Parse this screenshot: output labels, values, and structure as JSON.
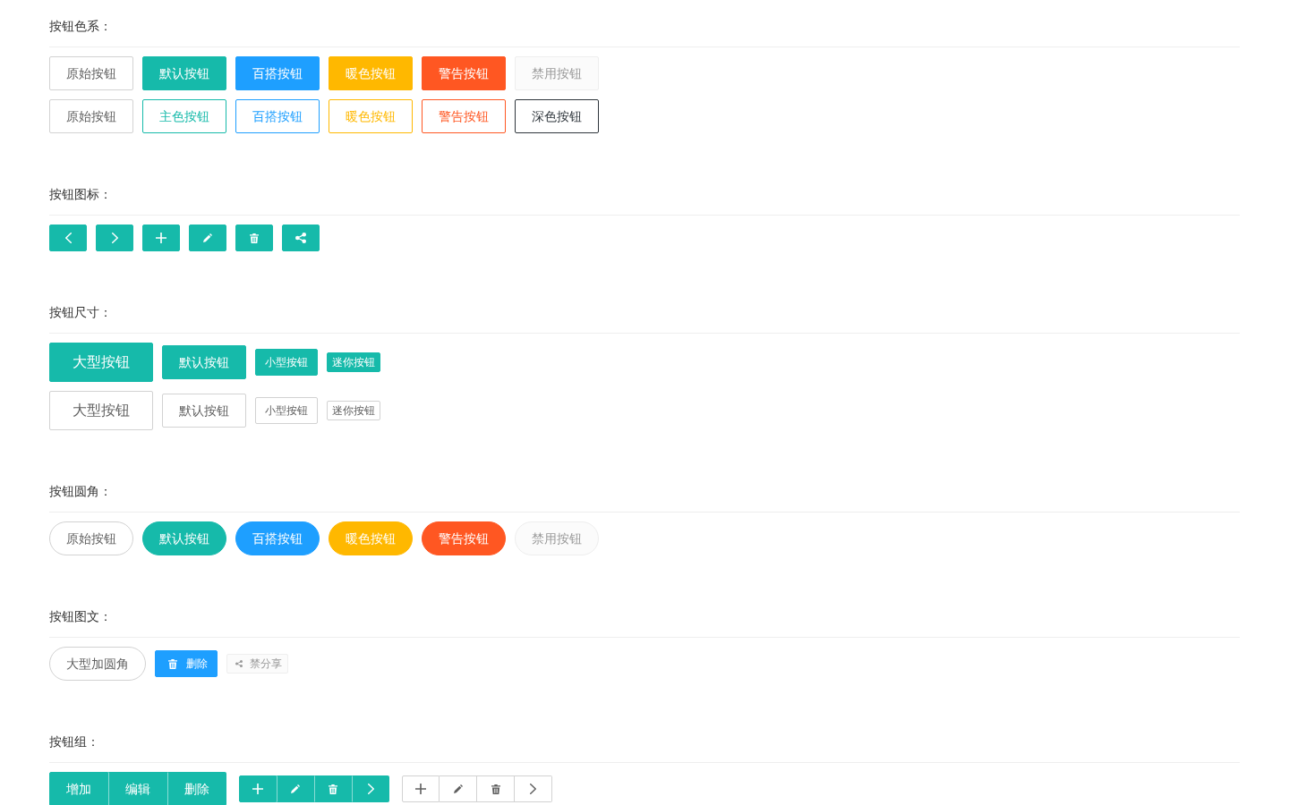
{
  "sections": [
    {
      "kind": "rows",
      "title": "按钮色系：",
      "rows": [
        {
          "buttons": [
            {
              "kind": "normal",
              "label": "原始按钮",
              "rounded": false,
              "disabled": false
            },
            {
              "kind": "normal",
              "label": "默认按钮",
              "color": "#16baaa",
              "outline": false,
              "rounded": false,
              "disabled": false
            },
            {
              "kind": "normal",
              "label": "百搭按钮",
              "color": "#1e9fff",
              "outline": false,
              "rounded": false,
              "disabled": false
            },
            {
              "kind": "normal",
              "label": "暖色按钮",
              "color": "#ffb800",
              "outline": false,
              "rounded": false,
              "disabled": false
            },
            {
              "kind": "normal",
              "label": "警告按钮",
              "color": "#ff5722",
              "outline": false,
              "rounded": false,
              "disabled": false
            },
            {
              "kind": "normal",
              "label": "禁用按钮",
              "rounded": false,
              "disabled": true
            }
          ]
        },
        {
          "buttons": [
            {
              "kind": "normal",
              "label": "原始按钮",
              "rounded": false,
              "disabled": false
            },
            {
              "kind": "normal",
              "label": "主色按钮",
              "color": "#16baaa",
              "outline": true,
              "rounded": false,
              "disabled": false
            },
            {
              "kind": "normal",
              "label": "百搭按钮",
              "color": "#1e9fff",
              "outline": true,
              "rounded": false,
              "disabled": false
            },
            {
              "kind": "normal",
              "label": "暖色按钮",
              "color": "#ffb800",
              "outline": true,
              "rounded": false,
              "disabled": false
            },
            {
              "kind": "normal",
              "label": "警告按钮",
              "color": "#ff5722",
              "outline": true,
              "rounded": false,
              "disabled": false
            },
            {
              "kind": "normal",
              "label": "深色按钮",
              "color": "#2f363c",
              "outline": true,
              "rounded": false,
              "disabled": false
            }
          ]
        }
      ]
    },
    {
      "kind": "rows",
      "title": "按钮图标：",
      "rows": [
        {
          "buttons": [
            {
              "kind": "previous",
              "color": "#16baaa",
              "outline": false,
              "rounded": false,
              "disabled": false,
              "mini": false
            },
            {
              "kind": "next",
              "color": "#16baaa",
              "outline": false,
              "rounded": false,
              "disabled": false,
              "mini": false
            },
            {
              "kind": "add",
              "color": "#16baaa",
              "outline": false,
              "rounded": false,
              "disabled": false,
              "mini": false
            },
            {
              "kind": "edit",
              "color": "#16baaa",
              "outline": false,
              "rounded": false,
              "disabled": false,
              "mini": false
            },
            {
              "kind": "delete",
              "color": "#16baaa",
              "outline": false,
              "rounded": false,
              "disabled": false,
              "mini": false
            },
            {
              "kind": "share",
              "color": "#16baaa",
              "outline": false,
              "rounded": false,
              "disabled": false,
              "mini": false
            }
          ]
        }
      ]
    },
    {
      "kind": "rows",
      "title": "按钮尺寸：",
      "rows": [
        {
          "buttons": [
            {
              "kind": "large",
              "label": "大型按钮",
              "color": "#16baaa",
              "outline": false,
              "rounded": false,
              "disabled": false
            },
            {
              "kind": "normal",
              "label": "默认按钮",
              "color": "#16baaa",
              "outline": false,
              "rounded": false,
              "disabled": false
            },
            {
              "kind": "small",
              "label": "小型按钮",
              "color": "#16baaa",
              "outline": false,
              "rounded": false,
              "disabled": false
            },
            {
              "kind": "mini",
              "label": "迷你按钮",
              "color": "#16baaa",
              "outline": false,
              "rounded": false,
              "disabled": false
            }
          ]
        },
        {
          "buttons": [
            {
              "kind": "large",
              "label": "大型按钮",
              "rounded": false,
              "disabled": false
            },
            {
              "kind": "normal",
              "label": "默认按钮",
              "rounded": false,
              "disabled": false
            },
            {
              "kind": "small",
              "label": "小型按钮",
              "rounded": false,
              "disabled": false
            },
            {
              "kind": "mini",
              "label": "迷你按钮",
              "rounded": false,
              "disabled": false
            }
          ]
        }
      ]
    },
    {
      "kind": "rows",
      "title": "按钮圆角：",
      "rows": [
        {
          "buttons": [
            {
              "kind": "normal",
              "label": "原始按钮",
              "rounded": true,
              "disabled": false
            },
            {
              "kind": "normal",
              "label": "默认按钮",
              "color": "#16baaa",
              "outline": false,
              "rounded": true,
              "disabled": false
            },
            {
              "kind": "normal",
              "label": "百搭按钮",
              "color": "#1e9fff",
              "outline": false,
              "rounded": true,
              "disabled": false
            },
            {
              "kind": "normal",
              "label": "暖色按钮",
              "color": "#ffb800",
              "outline": false,
              "rounded": true,
              "disabled": false
            },
            {
              "kind": "normal",
              "label": "警告按钮",
              "color": "#ff5722",
              "outline": false,
              "rounded": true,
              "disabled": false
            },
            {
              "kind": "normal",
              "label": "禁用按钮",
              "rounded": true,
              "disabled": true
            }
          ]
        }
      ]
    },
    {
      "kind": "rows",
      "title": "按钮图文：",
      "rows": [
        {
          "buttons": [
            {
              "kind": "normal",
              "label": "大型加圆角",
              "rounded": true,
              "disabled": false
            },
            {
              "kind": "delete",
              "label": "删除",
              "color": "#1e9fff",
              "outline": false,
              "rounded": false,
              "disabled": false,
              "mini": false
            },
            {
              "kind": "share",
              "label": "禁分享",
              "rounded": false,
              "disabled": true,
              "mini": true
            }
          ]
        }
      ]
    },
    {
      "kind": "groups",
      "title": "按钮组：",
      "groups": [
        {
          "kind": "normal",
          "color": "#16baaa",
          "buttons": [
            {
              "kind": "text",
              "label": "增加"
            },
            {
              "kind": "text",
              "label": "编辑"
            },
            {
              "kind": "text",
              "label": "删除"
            }
          ]
        },
        {
          "kind": "small",
          "color": "#16baaa",
          "buttons": [
            {
              "kind": "add"
            },
            {
              "kind": "edit"
            },
            {
              "kind": "delete"
            },
            {
              "kind": "next"
            }
          ]
        },
        {
          "kind": "small",
          "buttons": [
            {
              "kind": "add"
            },
            {
              "kind": "edit"
            },
            {
              "kind": "delete"
            },
            {
              "kind": "next"
            }
          ]
        }
      ]
    }
  ]
}
